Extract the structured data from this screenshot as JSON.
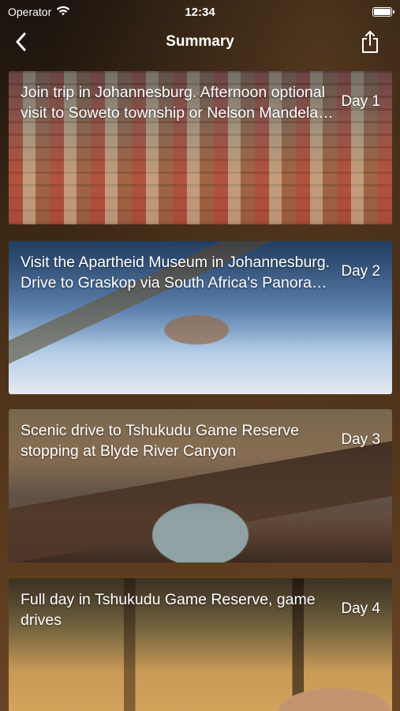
{
  "status_bar": {
    "carrier": "Operator",
    "time": "12:34"
  },
  "nav": {
    "title": "Summary"
  },
  "days": [
    {
      "title": "Join trip in Johannesburg. Afternoon optional visit to Soweto township or Nelson Mandela House",
      "day": "Day 1"
    },
    {
      "title": "Visit the Apartheid Museum in Johannesburg. Drive to Graskop via South Africa's Panorama Route",
      "day": "Day 2"
    },
    {
      "title": "Scenic drive to Tshukudu Game Reserve stopping at Blyde River Canyon",
      "day": "Day 3"
    },
    {
      "title": "Full day in Tshukudu Game Reserve, game drives",
      "day": "Day 4"
    }
  ],
  "icons": {
    "back": "chevron-left-icon",
    "share": "share-icon",
    "wifi": "wifi-icon",
    "battery": "battery-icon"
  }
}
